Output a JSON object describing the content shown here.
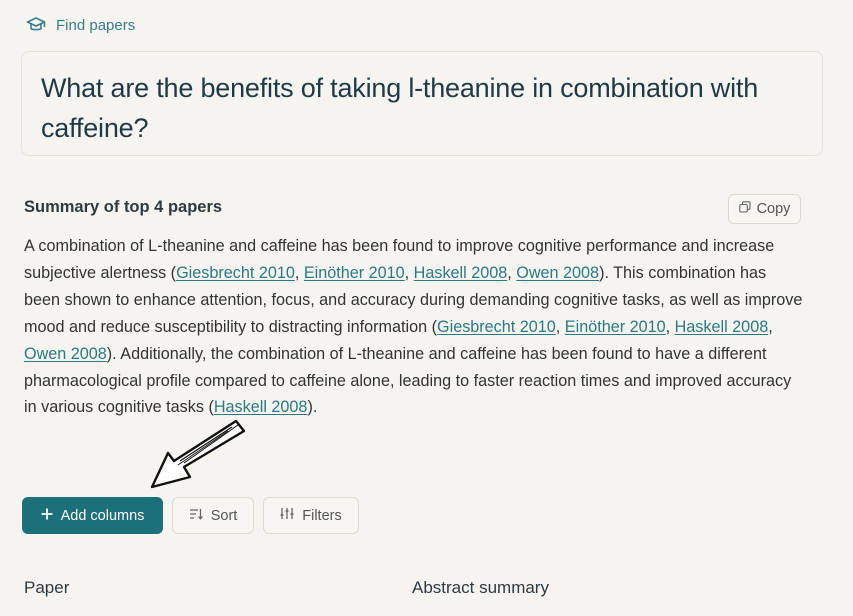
{
  "header": {
    "find_papers_label": "Find papers"
  },
  "question": {
    "text": "What are the benefits of taking l-theanine in combination with caffeine?"
  },
  "summary": {
    "title": "Summary of top 4 papers",
    "copy_label": "Copy",
    "parts": {
      "p1": "A combination of L-theanine and caffeine has been found to improve cognitive performance and increase subjective alertness (",
      "sep": ", ",
      "p2": "). This combination has been shown to enhance attention, focus, and accuracy during demanding cognitive tasks, as well as improve mood and reduce susceptibility to distracting information (",
      "p3": "). Additionally, the combination of L-theanine and caffeine has been found to have a different pharmacological profile compared to caffeine alone, leading to faster reaction times and improved accuracy in various cognitive tasks (",
      "p4": ")."
    },
    "citations": {
      "giesbrecht": "Giesbrecht 2010",
      "einother": "Einöther 2010",
      "haskell": "Haskell 2008",
      "owen": "Owen 2008"
    }
  },
  "toolbar": {
    "add_columns_label": "Add columns",
    "sort_label": "Sort",
    "filters_label": "Filters"
  },
  "table": {
    "columns": [
      "Paper",
      "Abstract summary"
    ]
  },
  "colors": {
    "accent": "#1d6f7a",
    "link": "#2b7a83",
    "background": "#f5f4f1"
  },
  "icons": [
    "graduation-cap-icon",
    "copy-icon",
    "plus-icon",
    "sort-icon",
    "sliders-icon",
    "annotation-arrow"
  ]
}
